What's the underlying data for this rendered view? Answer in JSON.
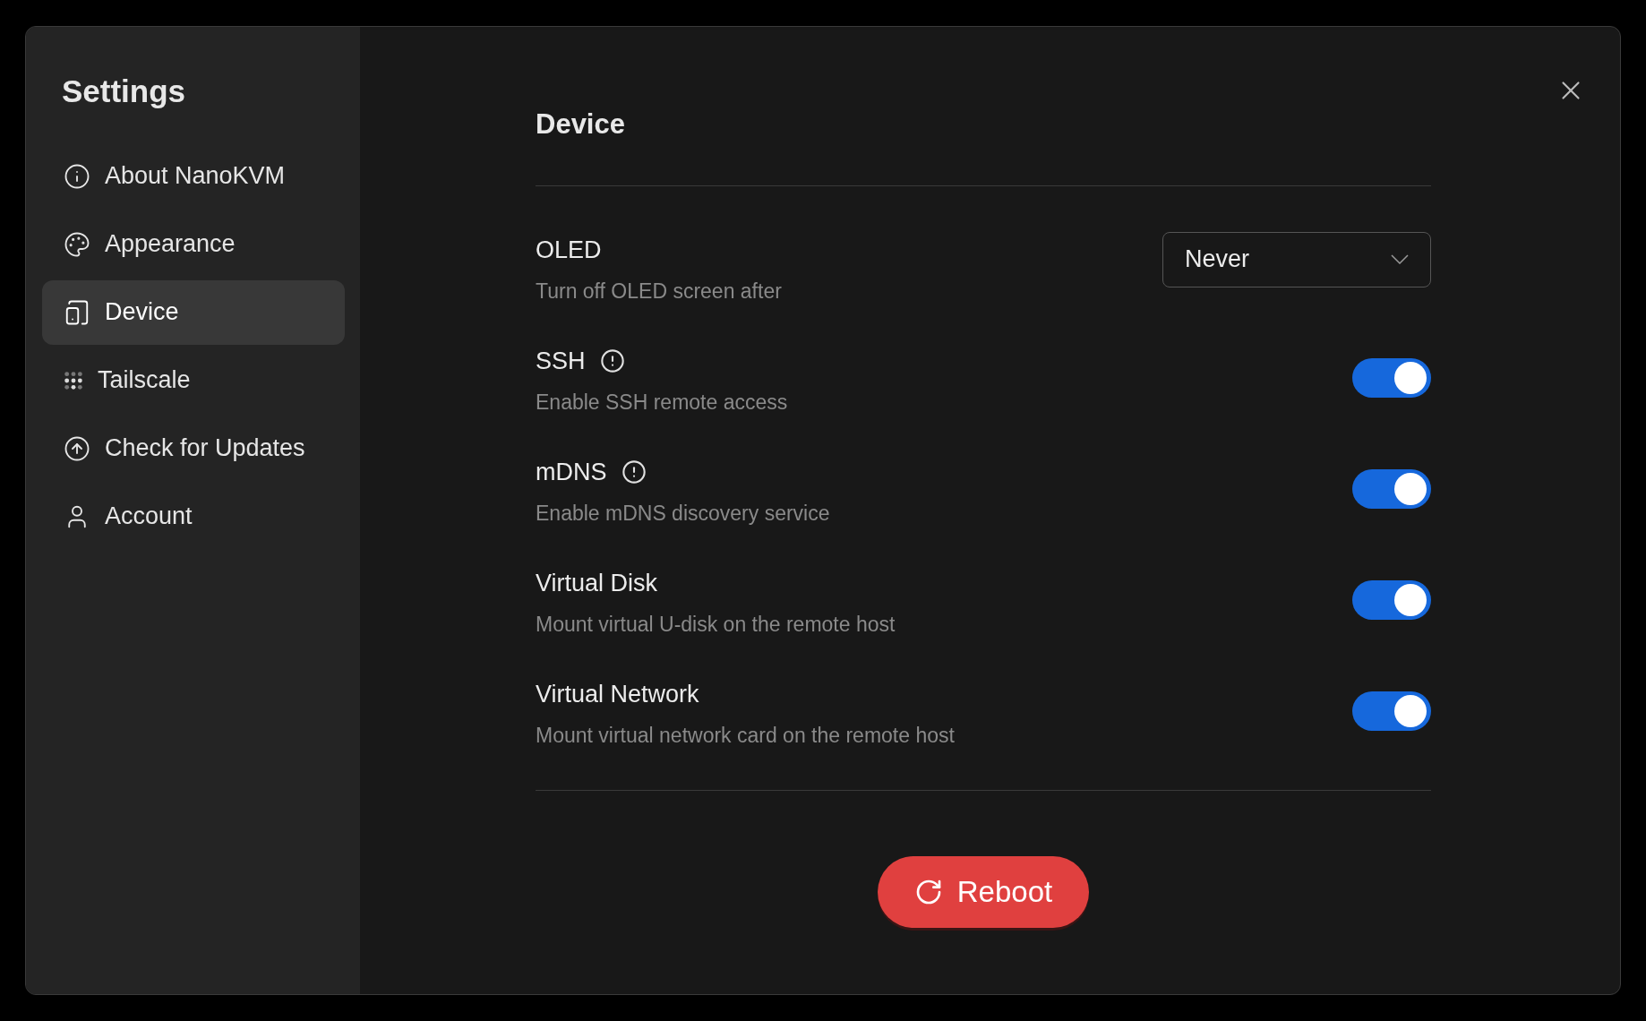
{
  "sidebar": {
    "title": "Settings",
    "items": [
      {
        "label": "About NanoKVM",
        "selected": false
      },
      {
        "label": "Appearance",
        "selected": false
      },
      {
        "label": "Device",
        "selected": true
      },
      {
        "label": "Tailscale",
        "selected": false
      },
      {
        "label": "Check for Updates",
        "selected": false
      },
      {
        "label": "Account",
        "selected": false
      }
    ]
  },
  "main": {
    "title": "Device",
    "settings": [
      {
        "kind": "select",
        "title": "OLED",
        "info": false,
        "description": "Turn off OLED screen after",
        "value": "Never"
      },
      {
        "kind": "toggle",
        "title": "SSH",
        "info": true,
        "description": "Enable SSH remote access",
        "on": true
      },
      {
        "kind": "toggle",
        "title": "mDNS",
        "info": true,
        "description": "Enable mDNS discovery service",
        "on": true
      },
      {
        "kind": "toggle",
        "title": "Virtual Disk",
        "info": false,
        "description": "Mount virtual U-disk on the remote host",
        "on": true
      },
      {
        "kind": "toggle",
        "title": "Virtual Network",
        "info": false,
        "description": "Mount virtual network card on the remote host",
        "on": true
      }
    ],
    "button": "Reboot"
  }
}
